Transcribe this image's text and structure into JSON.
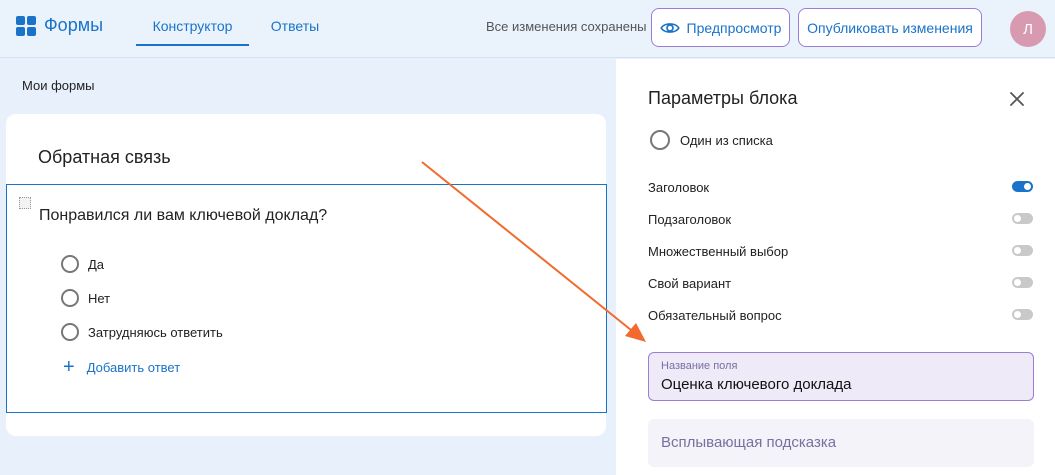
{
  "app": {
    "name": "Формы"
  },
  "tabs": [
    {
      "label": "Конструктор",
      "active": true
    },
    {
      "label": "Ответы",
      "active": false
    }
  ],
  "header": {
    "saved_status": "Все изменения сохранены",
    "preview_label": "Предпросмотр",
    "publish_label": "Опубликовать изменения",
    "avatar_letter": "Л"
  },
  "breadcrumb": "Мои формы",
  "form": {
    "title": "Обратная связь",
    "question": "Понравился ли вам ключевой доклад?",
    "options": [
      "Да",
      "Нет",
      "Затрудняюсь ответить"
    ],
    "add_answer_label": "Добавить ответ"
  },
  "panel": {
    "title": "Параметры блока",
    "block_type": "Один из списка",
    "settings": [
      {
        "label": "Заголовок",
        "enabled": true
      },
      {
        "label": "Подзаголовок",
        "enabled": false
      },
      {
        "label": "Множественный выбор",
        "enabled": false
      },
      {
        "label": "Свой вариант",
        "enabled": false
      },
      {
        "label": "Обязательный вопрос",
        "enabled": false
      }
    ],
    "field_name": {
      "label": "Название поля",
      "value": "Оценка ключевого доклада"
    },
    "tooltip": {
      "placeholder": "Всплывающая подсказка"
    }
  },
  "colors": {
    "accent": "#1a73c9",
    "focus_border": "#9c7dd6",
    "arrow": "#f26a2e"
  },
  "icons": {
    "logo": "grid-icon",
    "preview": "eye-icon",
    "close": "close-icon",
    "add": "plus-icon",
    "drag": "drag-handle-icon"
  }
}
